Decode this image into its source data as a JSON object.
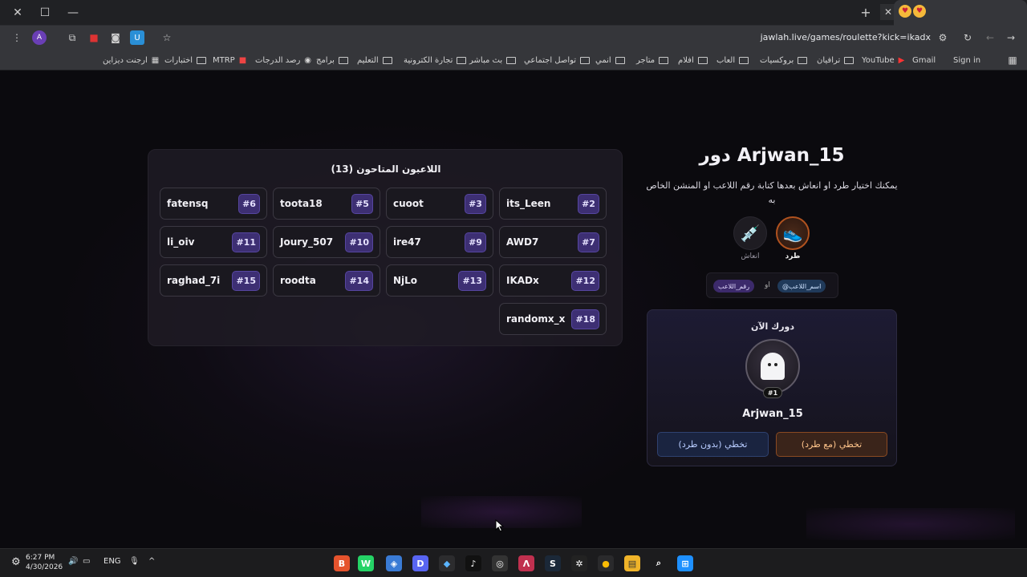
{
  "browser": {
    "window_buttons": {
      "close": "✕",
      "restore": "☐",
      "minimize": "—"
    },
    "new_tab": "+",
    "tab_close": "✕",
    "url": "jawlah.live/games/roulette?kick=ikadx",
    "profile_initial": "A",
    "bookmarks": [
      {
        "label": "Sign in"
      },
      {
        "label": "Gmail"
      },
      {
        "label": "YouTube"
      },
      {
        "label": "ترافيان"
      },
      {
        "label": "بروكسيات"
      },
      {
        "label": "العاب"
      },
      {
        "label": "افلام"
      },
      {
        "label": "متاجر"
      },
      {
        "label": "انمي"
      },
      {
        "label": "تواصل اجتماعي"
      },
      {
        "label": "بث مباشر"
      },
      {
        "label": "تجارة الكترونية"
      },
      {
        "label": "التعليم"
      },
      {
        "label": "برامج"
      },
      {
        "label": "رصد الدرجات"
      },
      {
        "label": "MTRP"
      },
      {
        "label": "اختبارات"
      },
      {
        "label": "ارجنت ديزاين"
      }
    ]
  },
  "players": {
    "title": "اللاعبون المتاحون (13)",
    "list": [
      {
        "name": "fatensq",
        "num": "#6"
      },
      {
        "name": "toota18",
        "num": "#5"
      },
      {
        "name": "cuoot",
        "num": "#3"
      },
      {
        "name": "its_Leen",
        "num": "#2"
      },
      {
        "name": "li_oiv",
        "num": "#11"
      },
      {
        "name": "Joury_507",
        "num": "#10"
      },
      {
        "name": "ire47",
        "num": "#9"
      },
      {
        "name": "AWD7",
        "num": "#7"
      },
      {
        "name": "raghad_7i",
        "num": "#15"
      },
      {
        "name": "roodta",
        "num": "#14"
      },
      {
        "name": "NjLo",
        "num": "#13"
      },
      {
        "name": "IKADx",
        "num": "#12"
      },
      {
        "name": "randomx_x",
        "num": "#18"
      }
    ]
  },
  "turn": {
    "title": "دور Arjwan_15",
    "description": "يمكنك اختيار طرد او انعاش بعدها كتابة رقم اللاعب او المنشن الخاص به",
    "actions": {
      "kick": "طرد",
      "revive": "انعاش"
    },
    "hint": {
      "mention": "@اسم_اللاعب",
      "or": "او",
      "number": "رقم_اللاعب"
    },
    "card_title": "دورك الآن",
    "rank": "#1",
    "player_name": "Arjwan_15",
    "btn_with_kick": "تخطي (مع طرد)",
    "btn_without_kick": "تخطي (بدون طرد)"
  },
  "taskbar": {
    "time": "6:27 PM",
    "date": "4/30/2026",
    "lang": "ENG"
  },
  "colors": {
    "accent_purple": "#3d2f73",
    "kick_orange": "#b0521f",
    "background": "#0b0a0e"
  }
}
